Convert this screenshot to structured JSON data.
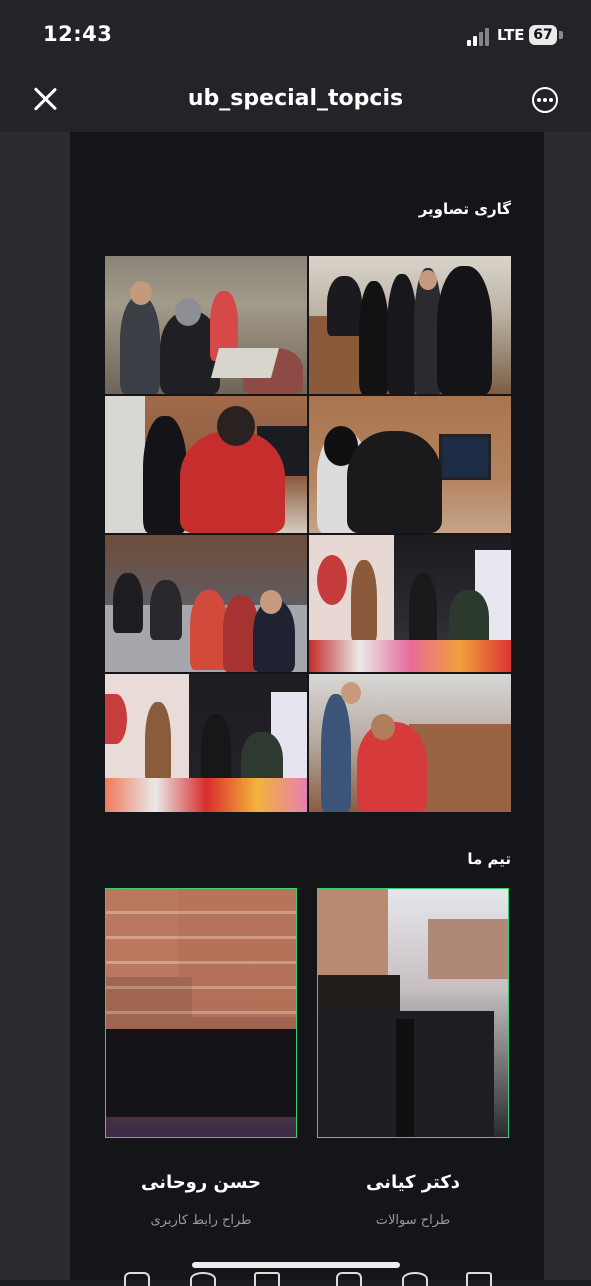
{
  "status_bar": {
    "time": "12:43",
    "network": "LTE",
    "battery": "67"
  },
  "nav": {
    "title": "ub_special_topcis"
  },
  "gallery": {
    "title": "گاری تصاویر"
  },
  "team": {
    "title": "تیم ما",
    "members": [
      {
        "name": "حسن روحانی",
        "role": "طراح رابط کاربری"
      },
      {
        "name": "دکتر کیانی",
        "role": "طراح سوالات"
      }
    ]
  },
  "colors": {
    "accent_border": "#3ccf78",
    "content_bg": "#141518",
    "bar_bg": "#232428"
  }
}
